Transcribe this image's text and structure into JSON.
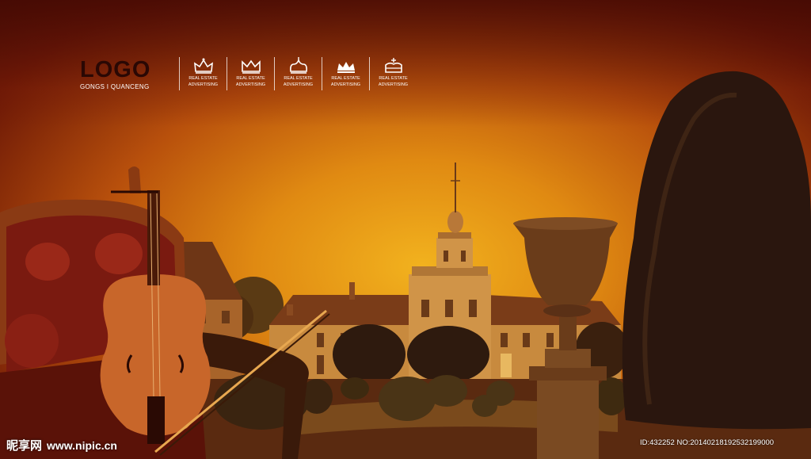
{
  "branding": {
    "logo": "LOGO",
    "logo_subtitle": "GONGS I QUANCENG"
  },
  "badges": [
    {
      "icon": "crown-icon",
      "line1": "REAL ESTATE",
      "line2": "ADVERTISING"
    },
    {
      "icon": "crown-icon",
      "line1": "REAL ESTATE",
      "line2": "ADVERTISING"
    },
    {
      "icon": "crown-icon",
      "line1": "REAL ESTATE",
      "line2": "ADVERTISING"
    },
    {
      "icon": "crown-icon",
      "line1": "REAL ESTATE",
      "line2": "ADVERTISING"
    },
    {
      "icon": "crown-icon",
      "line1": "REAL ESTATE",
      "line2": "ADVERTISING"
    }
  ],
  "watermark": {
    "site": "昵享网",
    "url": "www.nipic.cn",
    "id_text": "ID:432252 NO:20140218192532199000"
  },
  "colors": {
    "sky_center": "#f2b21e",
    "sky_edge": "#4a0d04",
    "logo": "#2a0804",
    "accent": "#ffffff"
  }
}
